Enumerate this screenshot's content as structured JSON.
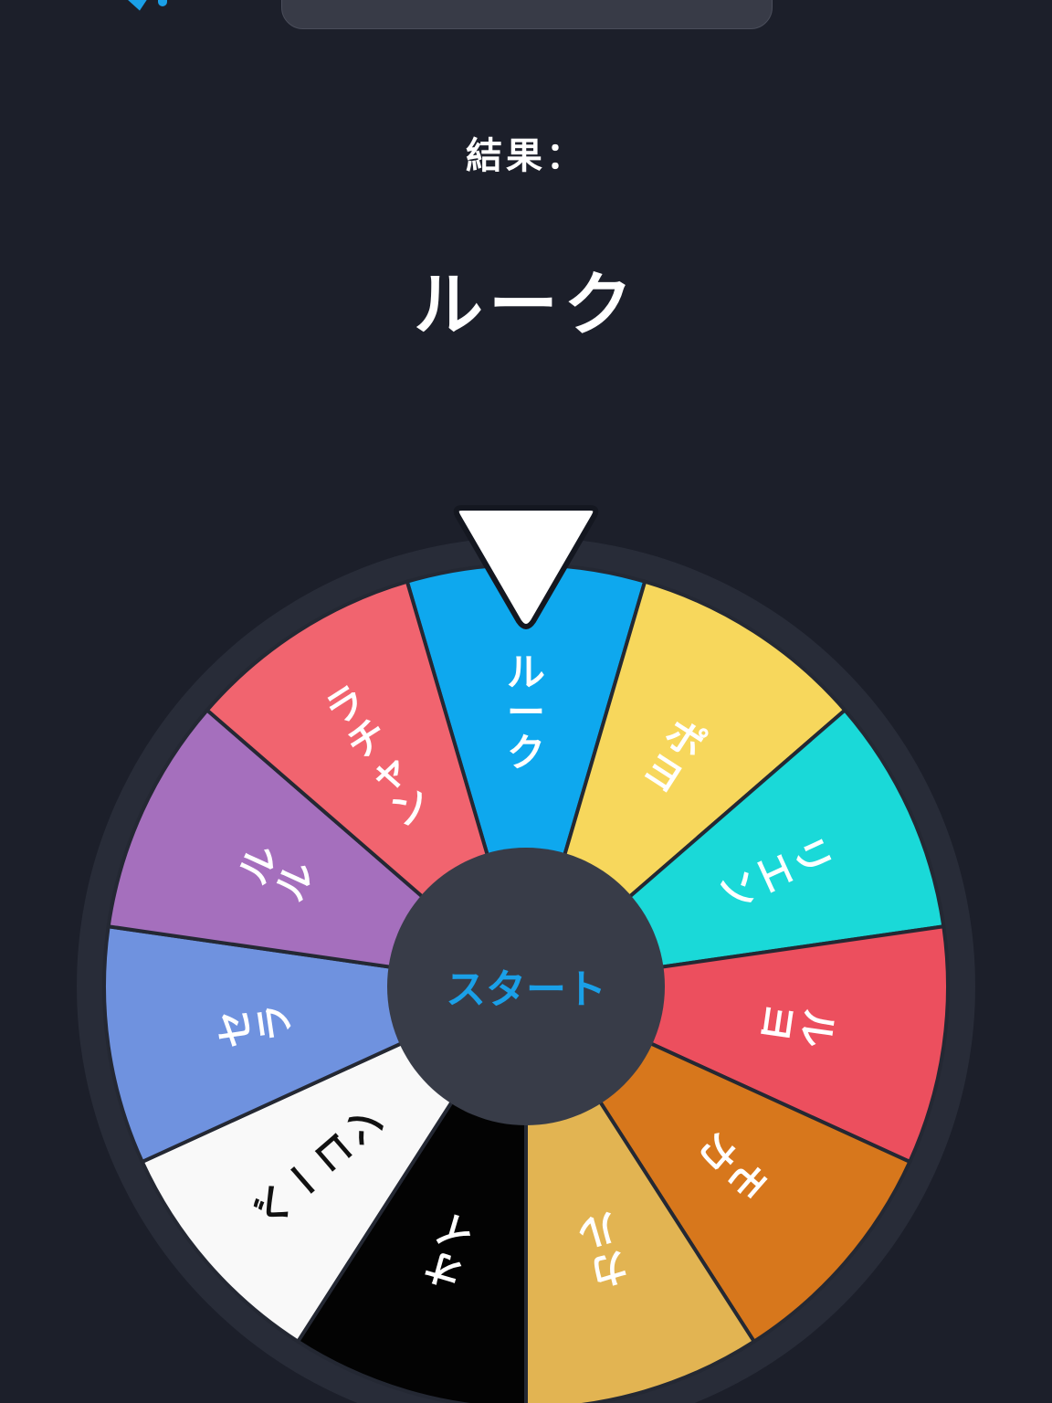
{
  "header": {
    "left_icon": "bluetooth-icon",
    "right_icon": "circle-icon"
  },
  "result": {
    "label": "結果：",
    "value": "ルーク"
  },
  "wheel": {
    "pointer_icon": "pointer-triangle-icon",
    "start_label": "スタート",
    "segments": [
      {
        "label": "ルーク",
        "color": "#0ea8ee",
        "text_color": "#ffffff"
      },
      {
        "label": "ポヨ",
        "color": "#f7d75c",
        "text_color": "#ffffff"
      },
      {
        "label": "リエン",
        "color": "#1ad9d8",
        "text_color": "#ffffff"
      },
      {
        "label": "ルヨ",
        "color": "#ec4f5e",
        "text_color": "#ffffff"
      },
      {
        "label": "モカ",
        "color": "#d7771c",
        "text_color": "#ffffff"
      },
      {
        "label": "カル",
        "color": "#e2b452",
        "text_color": "#ffffff"
      },
      {
        "label": "オイ",
        "color": "#030303",
        "text_color": "#ffffff"
      },
      {
        "label": "ベーコン",
        "color": "#f9f9f9",
        "text_color": "#111111"
      },
      {
        "label": "セラ",
        "color": "#6f92df",
        "text_color": "#ffffff"
      },
      {
        "label": "ルル",
        "color": "#a56fbd",
        "text_color": "#ffffff"
      },
      {
        "label": "ラチャン",
        "color": "#f1646f",
        "text_color": "#ffffff"
      }
    ]
  }
}
